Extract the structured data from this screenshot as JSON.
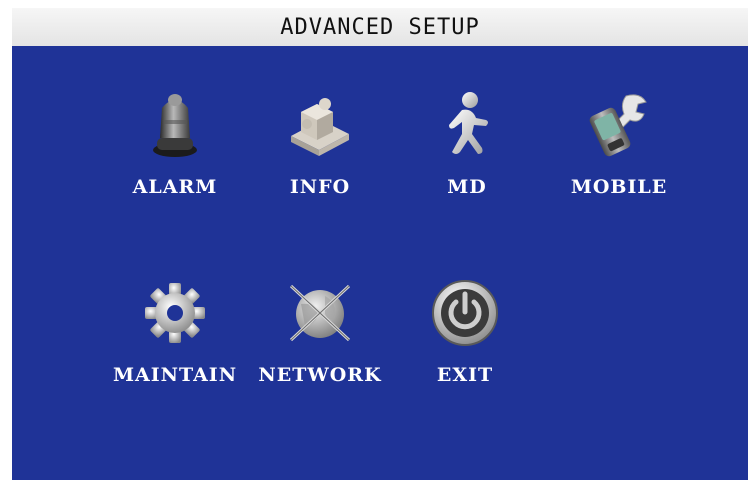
{
  "title": "ADVANCED SETUP",
  "menu": {
    "alarm": {
      "label": "ALARM",
      "icon": "alarm-siren-icon"
    },
    "info": {
      "label": "INFO",
      "icon": "info-puzzle-icon"
    },
    "md": {
      "label": "MD",
      "icon": "motion-runner-icon"
    },
    "mobile": {
      "label": "MOBILE",
      "icon": "mobile-phone-icon"
    },
    "maintain": {
      "label": "MAINTAIN",
      "icon": "gear-icon"
    },
    "network": {
      "label": "NETWORK",
      "icon": "globe-network-icon"
    },
    "exit": {
      "label": "EXIT",
      "icon": "power-icon"
    }
  },
  "colors": {
    "panel": "#1f3397",
    "titlebar": "#eeeeee",
    "label": "#ffffff"
  }
}
